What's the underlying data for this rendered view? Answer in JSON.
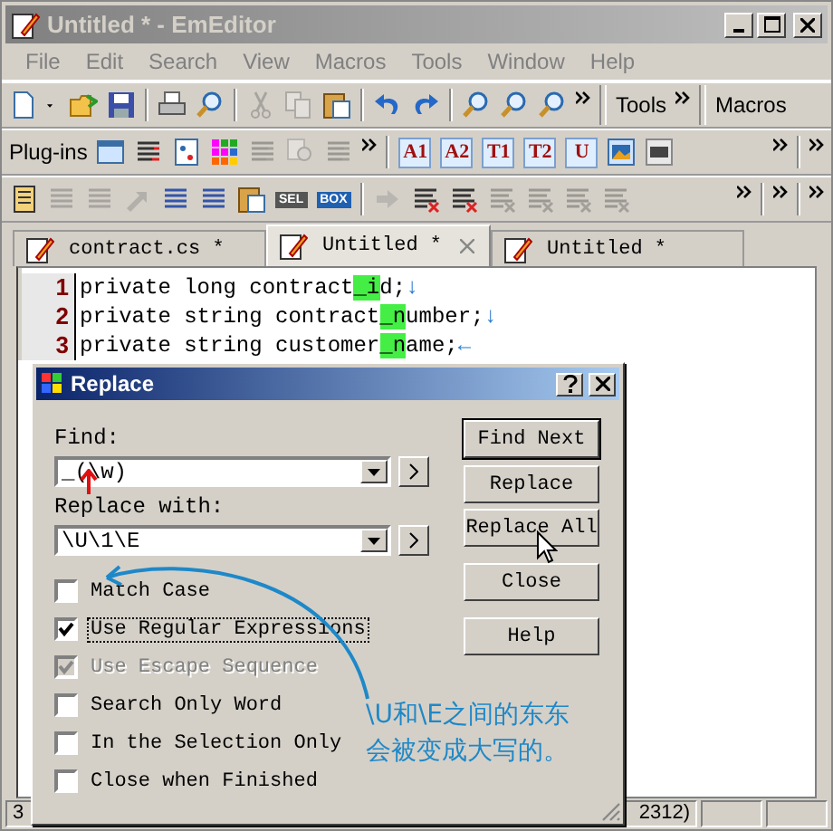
{
  "window": {
    "title": "Untitled * - EmEditor",
    "active": false
  },
  "menu": [
    "File",
    "Edit",
    "Search",
    "View",
    "Macros",
    "Tools",
    "Window",
    "Help"
  ],
  "toolbars": {
    "tools_label": "Tools",
    "macros_label": "Macros",
    "plugins_label": "Plug-ins",
    "letter_buttons": [
      "A1",
      "A2",
      "T1",
      "T2",
      "U"
    ],
    "sel_label": "SEL",
    "box_label": "BOX"
  },
  "tabs": [
    {
      "label": "contract.cs *",
      "selected": false
    },
    {
      "label": "Untitled *",
      "selected": true
    },
    {
      "label": "Untitled *",
      "selected": false
    }
  ],
  "editor": {
    "lines": [
      {
        "number": "1",
        "before": "private long contract",
        "match": "_i",
        "after": "d;",
        "eol": "↓"
      },
      {
        "number": "2",
        "before": "private string contract",
        "match": "_n",
        "after": "umber;",
        "eol": "↓"
      },
      {
        "number": "3",
        "before": "private string customer",
        "match": "_n",
        "after": "ame;",
        "eol": "←"
      }
    ]
  },
  "dialog": {
    "title": "Replace",
    "find": {
      "label": "Find:",
      "value": "_(\\w)"
    },
    "replace": {
      "label": "Replace with:",
      "value": "\\U\\1\\E"
    },
    "buttons": [
      {
        "label": "Find Next",
        "default": true
      },
      {
        "label": "Replace",
        "default": false
      },
      {
        "label": "Replace All",
        "default": false
      },
      {
        "label": "Close",
        "default": false
      },
      {
        "label": "Help",
        "default": false
      }
    ],
    "options": [
      {
        "label": "Match Case",
        "checked": false,
        "disabled": false,
        "focused": false
      },
      {
        "label": "Use Regular Expressions",
        "checked": true,
        "disabled": false,
        "focused": true
      },
      {
        "label": "Use Escape Sequence",
        "checked": true,
        "disabled": true,
        "focused": false
      },
      {
        "label": "Search Only Word",
        "checked": false,
        "disabled": false,
        "focused": false
      },
      {
        "label": "In the Selection Only",
        "checked": false,
        "disabled": false,
        "focused": false
      },
      {
        "label": "Close when Finished",
        "checked": false,
        "disabled": false,
        "focused": false
      }
    ],
    "annotation_lines": [
      "\\U和\\E之间的东东",
      "会被变成大写的。"
    ]
  },
  "status_bar": [
    "3",
    "2312)"
  ]
}
